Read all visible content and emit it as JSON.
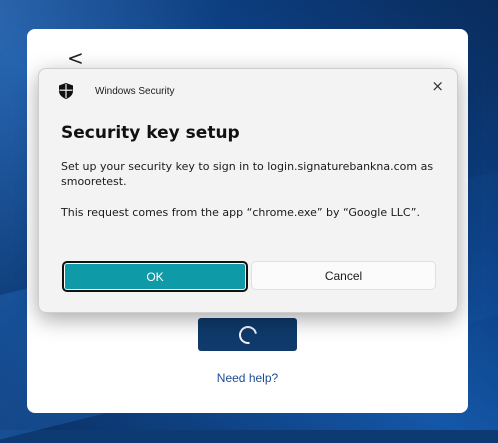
{
  "background_page": {
    "back_icon": "chevron-left-icon",
    "back_glyph": "<",
    "spinner_icon": "loading-spinner-icon",
    "need_help": "Need help?"
  },
  "dialog": {
    "app_icon": "shield-icon",
    "app_name": "Windows Security",
    "close_glyph": "×",
    "title": "Security key setup",
    "message_line": "Set up your security key to sign in to login.signaturebankna.com as smooretest.",
    "request_line": "This request comes from the app “chrome.exe” by “Google LLC”.",
    "ok_label": "OK",
    "cancel_label": "Cancel"
  },
  "colors": {
    "accent": "#0e9aa7",
    "primary_button_bg": "#0f3a6b",
    "link": "#1a4d99"
  }
}
